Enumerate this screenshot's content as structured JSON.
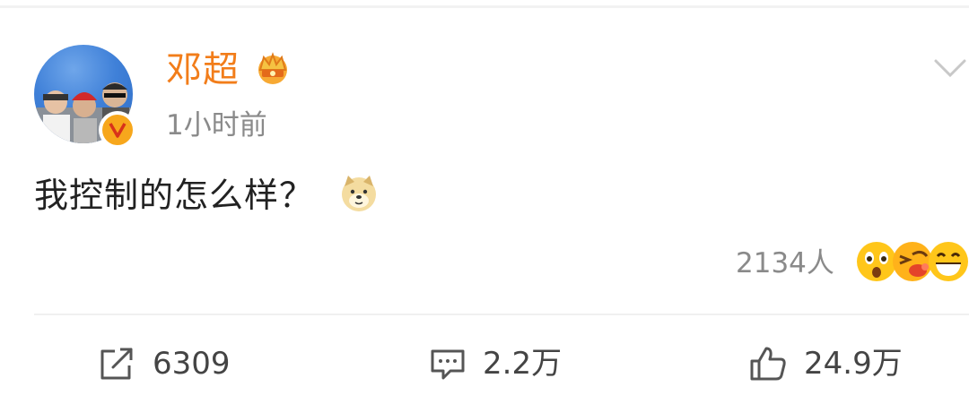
{
  "post": {
    "author": "邓超",
    "timestamp": "1小时前",
    "text": "我控制的怎么样？",
    "reaction_count": "2134人"
  },
  "actions": {
    "repost_count": "6309",
    "comment_count": "2.2万",
    "like_count": "24.9万"
  },
  "icons": {
    "crown": "crown-icon",
    "verified": "verified-v-icon",
    "menu": "chevron-down-icon",
    "inline_emoji": "doge-icon",
    "reactions": [
      "surprised-icon",
      "laughing-icon",
      "grin-icon"
    ],
    "repost": "repost-icon",
    "comment": "comment-icon",
    "like": "thumbs-up-icon"
  },
  "colors": {
    "username": "#f27d1a",
    "meta_text": "#8a8a8a",
    "body_text": "#222222",
    "verified_badge": "#f7a71c"
  }
}
